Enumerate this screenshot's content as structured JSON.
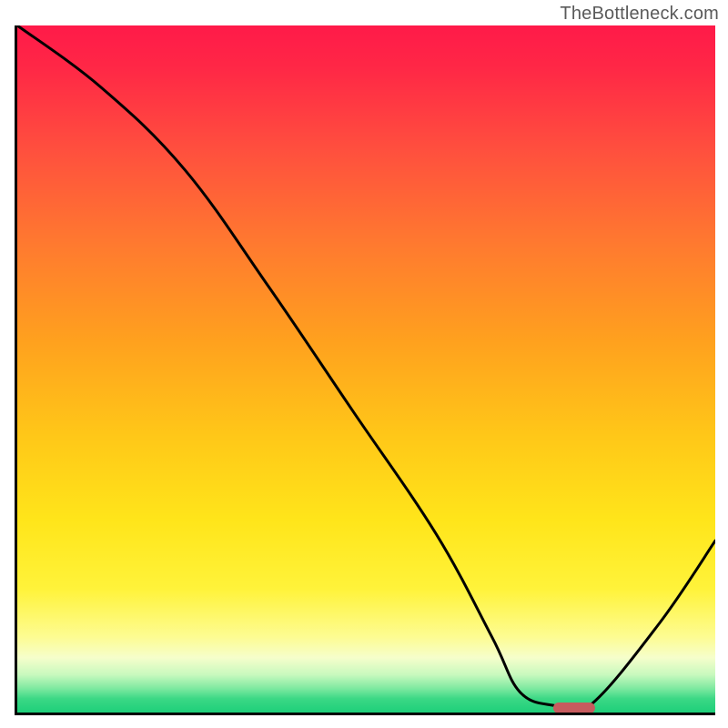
{
  "watermark": "TheBottleneck.com",
  "chart_data": {
    "type": "line",
    "title": "",
    "xlabel": "",
    "ylabel": "",
    "xlim": [
      0,
      100
    ],
    "ylim": [
      0,
      100
    ],
    "grid": false,
    "axes": {
      "left": true,
      "bottom": true,
      "right": false,
      "top": false
    },
    "background": {
      "type": "vertical-gradient",
      "description": "green (bottom) → yellow → orange → red (top)"
    },
    "series": [
      {
        "name": "bottleneck-curve",
        "color": "#000000",
        "x": [
          0,
          12,
          24,
          36,
          48,
          60,
          68,
          72,
          77,
          82,
          92,
          100
        ],
        "values": [
          100,
          91,
          79,
          62,
          44,
          26,
          11,
          3,
          1,
          1,
          13,
          25
        ]
      }
    ],
    "marker": {
      "name": "optimal-range",
      "shape": "rounded-bar",
      "color": "#c75b5e",
      "x_center": 79.5,
      "y": 1,
      "width_x_units": 6
    }
  }
}
